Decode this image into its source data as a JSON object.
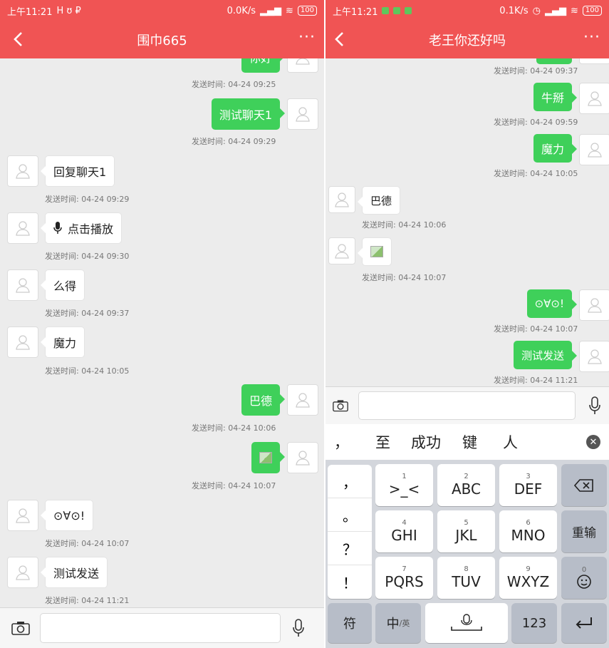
{
  "left": {
    "status": {
      "time": "上午11:21",
      "speed": "0.0K/s",
      "battery": "100"
    },
    "title": "围巾665",
    "messages": [
      {
        "dir": "out",
        "text": "你好",
        "time": "发送时间:  04-24 09:25"
      },
      {
        "dir": "out",
        "text": "测试聊天1",
        "time": "发送时间:  04-24 09:29"
      },
      {
        "dir": "in",
        "text": "回复聊天1",
        "time": "发送时间:  04-24 09:29"
      },
      {
        "dir": "in",
        "text": "点击播放",
        "time": "发送时间:  04-24 09:30"
      },
      {
        "dir": "in",
        "text": "么得",
        "time": "发送时间:  04-24 09:37"
      },
      {
        "dir": "in",
        "text": "魔力",
        "time": "发送时间:  04-24 10:05"
      },
      {
        "dir": "out",
        "text": "巴德",
        "time": "发送时间:  04-24 10:06"
      },
      {
        "dir": "out",
        "text": "",
        "time": "发送时间:  04-24 10:07"
      },
      {
        "dir": "in",
        "text": "⊙∀⊙!",
        "time": "发送时间:  04-24 10:07"
      },
      {
        "dir": "in",
        "text": "测试发送",
        "time": "发送时间:  04-24 11:21"
      }
    ]
  },
  "right": {
    "status": {
      "time": "上午11:21",
      "speed": "0.1K/s",
      "battery": "100"
    },
    "title": "老王你还好吗",
    "messages": [
      {
        "dir": "out",
        "text": "",
        "time": "发送时间:  04-24 09:37"
      },
      {
        "dir": "out",
        "text": "牛掰",
        "time": "发送时间:  04-24 09:59"
      },
      {
        "dir": "out",
        "text": "魔力",
        "time": "发送时间:  04-24 10:05"
      },
      {
        "dir": "in",
        "text": "巴德",
        "time": "发送时间:  04-24 10:06"
      },
      {
        "dir": "in",
        "text": "",
        "time": "发送时间:  04-24 10:07"
      },
      {
        "dir": "out",
        "text": "⊙∀⊙!",
        "time": "发送时间:  04-24 10:07"
      },
      {
        "dir": "out",
        "text": "测试发送",
        "time": "发送时间:  04-24 11:21"
      }
    ],
    "candidates": [
      "，",
      "至",
      "成功",
      "键",
      "人"
    ],
    "keyboard": {
      "punct": [
        "，",
        "。",
        "？",
        "！"
      ],
      "keys": [
        {
          "num": "1",
          "label": ">_<"
        },
        {
          "num": "2",
          "label": "ABC"
        },
        {
          "num": "3",
          "label": "DEF"
        },
        {
          "num": "4",
          "label": "GHI"
        },
        {
          "num": "5",
          "label": "JKL"
        },
        {
          "num": "6",
          "label": "MNO"
        },
        {
          "num": "7",
          "label": "PQRS"
        },
        {
          "num": "8",
          "label": "TUV"
        },
        {
          "num": "9",
          "label": "WXYZ"
        }
      ],
      "retype": "重输",
      "emoji_num": "0",
      "symbols": "符",
      "lang": "中",
      "lang_sub": "/英",
      "numbers": "123"
    }
  },
  "colors": {
    "header": "#f05454",
    "out_bubble": "#3fd05a"
  }
}
